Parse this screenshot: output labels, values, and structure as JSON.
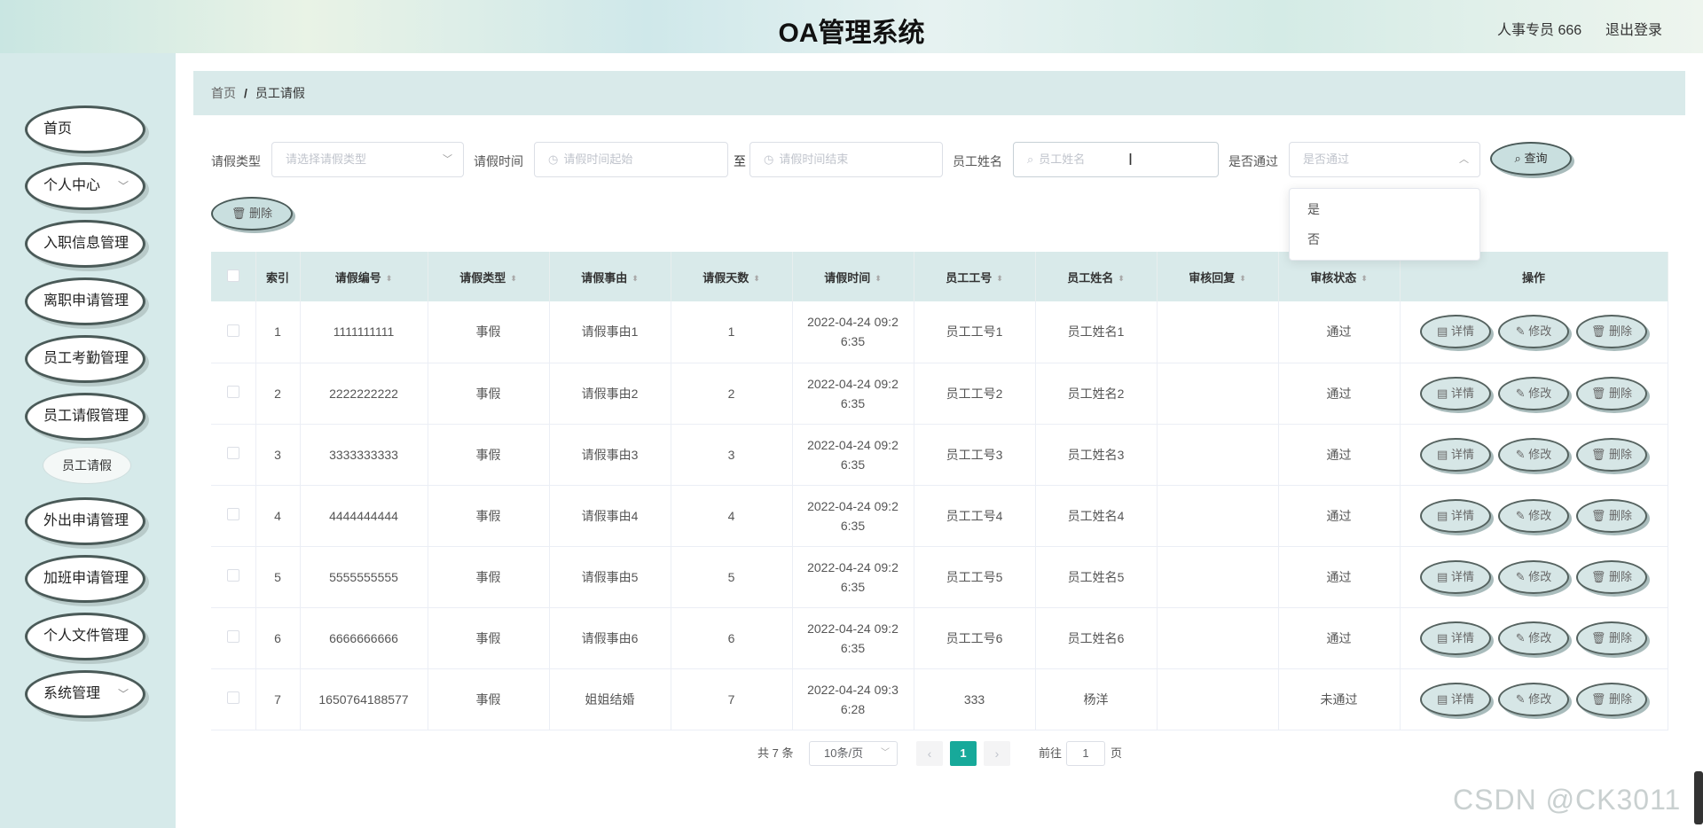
{
  "header": {
    "title": "OA管理系统",
    "user": "人事专员 666",
    "logout": "退出登录"
  },
  "sidebar": {
    "items": [
      {
        "label": "首页",
        "has_arrow": false
      },
      {
        "label": "个人中心",
        "has_arrow": true
      },
      {
        "label": "入职信息管理",
        "has_arrow": false
      },
      {
        "label": "离职申请管理",
        "has_arrow": false
      },
      {
        "label": "员工考勤管理",
        "has_arrow": false
      },
      {
        "label": "员工请假管理",
        "has_arrow": false
      },
      {
        "label": "外出申请管理",
        "has_arrow": false
      },
      {
        "label": "加班申请管理",
        "has_arrow": false
      },
      {
        "label": "个人文件管理",
        "has_arrow": false
      },
      {
        "label": "系统管理",
        "has_arrow": true
      }
    ],
    "sub_item": "员工请假"
  },
  "breadcrumb": {
    "home": "首页",
    "sep": "/",
    "current": "员工请假"
  },
  "filters": {
    "type_label": "请假类型",
    "type_placeholder": "请选择请假类型",
    "time_label": "请假时间",
    "time_start_placeholder": "请假时间起始",
    "time_to": "至",
    "time_end_placeholder": "请假时间结束",
    "name_label": "员工姓名",
    "name_placeholder": "员工姓名",
    "pass_label": "是否通过",
    "pass_placeholder": "是否通过",
    "query": "查询",
    "delete": "删除"
  },
  "dropdown": {
    "options": [
      "是",
      "否"
    ]
  },
  "table": {
    "headers": [
      "索引",
      "请假编号",
      "请假类型",
      "请假事由",
      "请假天数",
      "请假时间",
      "员工工号",
      "员工姓名",
      "审核回复",
      "审核状态",
      "操作"
    ],
    "rows": [
      {
        "idx": "1",
        "no": "1111111111",
        "type": "事假",
        "reason": "请假事由1",
        "days": "1",
        "time1": "2022-04-24 09:2",
        "time2": "6:35",
        "empno": "员工工号1",
        "name": "员工姓名1",
        "reply": "",
        "status": "通过"
      },
      {
        "idx": "2",
        "no": "2222222222",
        "type": "事假",
        "reason": "请假事由2",
        "days": "2",
        "time1": "2022-04-24 09:2",
        "time2": "6:35",
        "empno": "员工工号2",
        "name": "员工姓名2",
        "reply": "",
        "status": "通过"
      },
      {
        "idx": "3",
        "no": "3333333333",
        "type": "事假",
        "reason": "请假事由3",
        "days": "3",
        "time1": "2022-04-24 09:2",
        "time2": "6:35",
        "empno": "员工工号3",
        "name": "员工姓名3",
        "reply": "",
        "status": "通过"
      },
      {
        "idx": "4",
        "no": "4444444444",
        "type": "事假",
        "reason": "请假事由4",
        "days": "4",
        "time1": "2022-04-24 09:2",
        "time2": "6:35",
        "empno": "员工工号4",
        "name": "员工姓名4",
        "reply": "",
        "status": "通过"
      },
      {
        "idx": "5",
        "no": "5555555555",
        "type": "事假",
        "reason": "请假事由5",
        "days": "5",
        "time1": "2022-04-24 09:2",
        "time2": "6:35",
        "empno": "员工工号5",
        "name": "员工姓名5",
        "reply": "",
        "status": "通过"
      },
      {
        "idx": "6",
        "no": "6666666666",
        "type": "事假",
        "reason": "请假事由6",
        "days": "6",
        "time1": "2022-04-24 09:2",
        "time2": "6:35",
        "empno": "员工工号6",
        "name": "员工姓名6",
        "reply": "",
        "status": "通过"
      },
      {
        "idx": "7",
        "no": "1650764188577",
        "type": "事假",
        "reason": "姐姐结婚",
        "days": "7",
        "time1": "2022-04-24 09:3",
        "time2": "6:28",
        "empno": "333",
        "name": "杨洋",
        "reply": "",
        "status": "未通过"
      }
    ],
    "actions": {
      "detail": "详情",
      "edit": "修改",
      "delete": "删除"
    }
  },
  "pagination": {
    "total": "共 7 条",
    "size": "10条/页",
    "current": "1",
    "goto": "前往",
    "page_input": "1",
    "page_unit": "页",
    "prev": "‹",
    "next": "›"
  },
  "watermark": "CSDN @CK3011",
  "icons": {
    "search": "search-icon",
    "clock": "clock-icon",
    "trash": "trash-icon",
    "doc": "document-icon",
    "edit": "edit-icon",
    "chevron": "chevron-down-icon"
  }
}
